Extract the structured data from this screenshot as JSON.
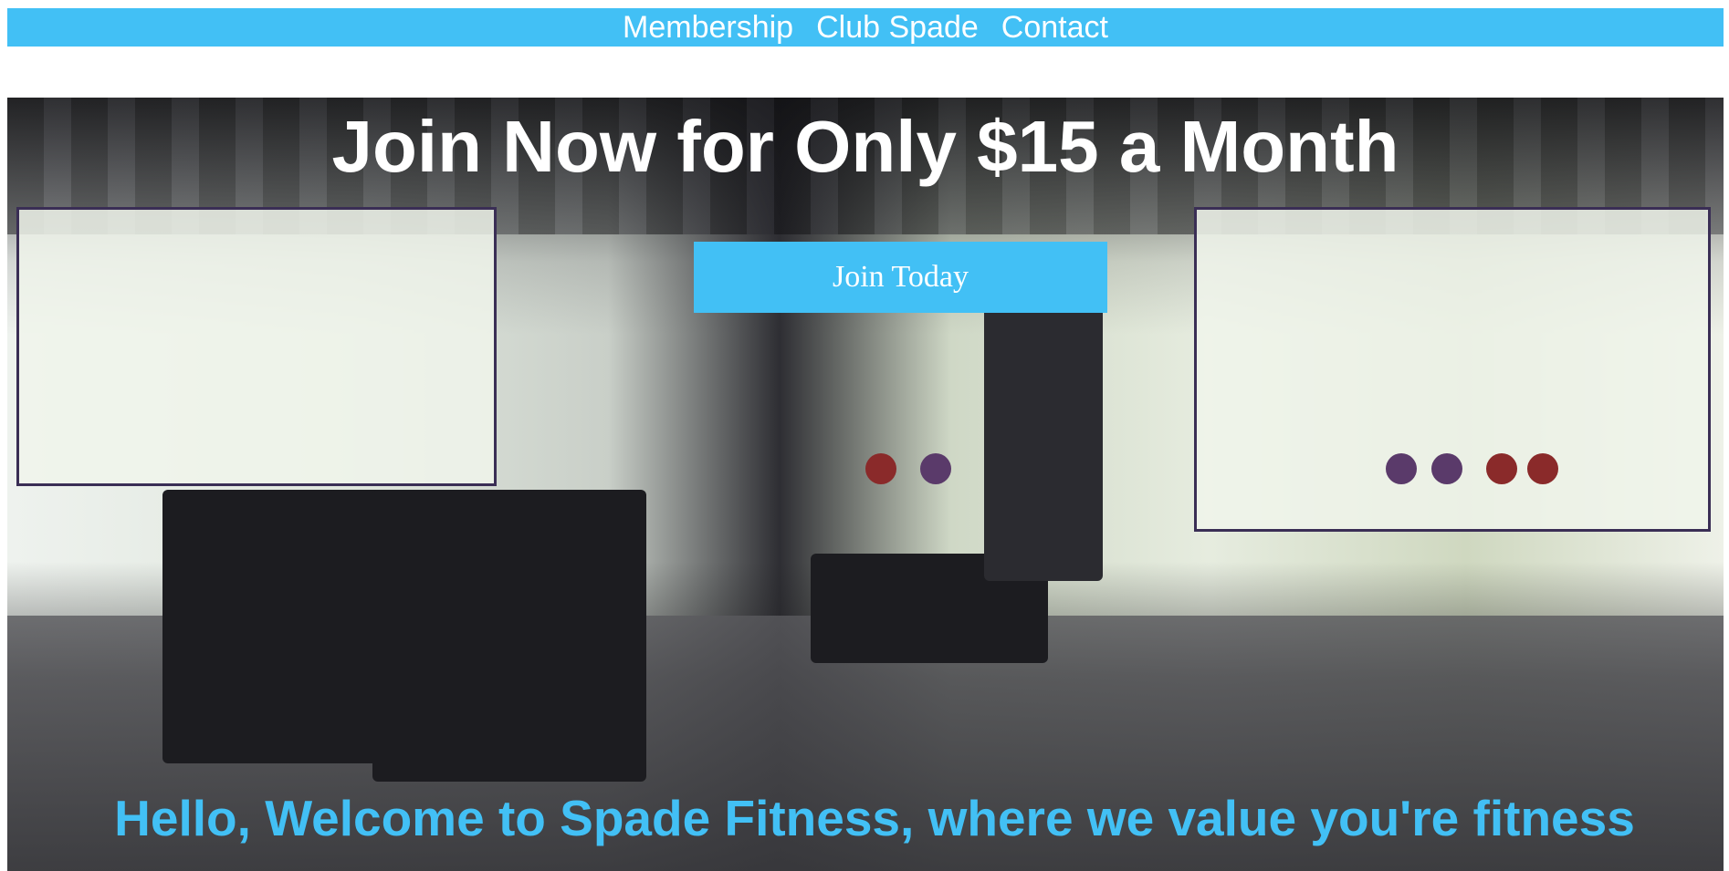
{
  "nav": {
    "items": [
      {
        "label": "Membership"
      },
      {
        "label": "Club Spade"
      },
      {
        "label": "Contact"
      }
    ]
  },
  "hero": {
    "title": "Join Now for Only $15 a Month",
    "button_label": "Join Today",
    "welcome_text": "Hello, Welcome to Spade Fitness, where we value you're fitness"
  },
  "colors": {
    "accent": "#42c0f5",
    "hero_text": "#ffffff"
  }
}
